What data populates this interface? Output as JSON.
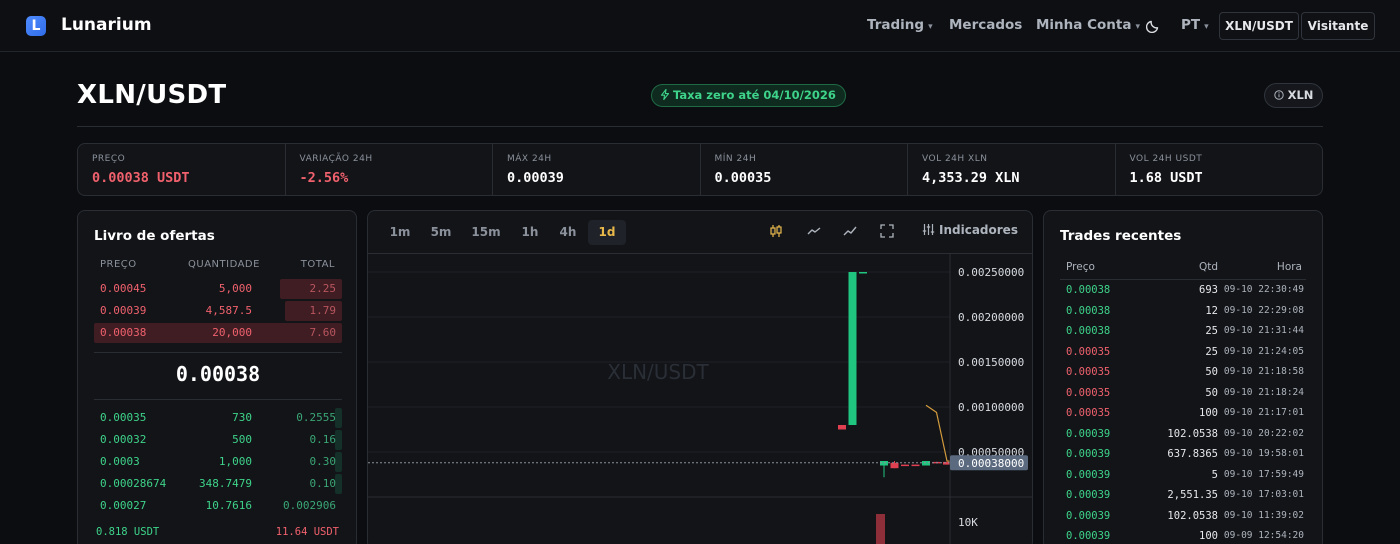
{
  "nav": {
    "brand": "Lunarium",
    "logo_letter": "L",
    "items": [
      {
        "label": "Trading",
        "caret": "▾"
      },
      {
        "label": "Mercados",
        "caret": ""
      },
      {
        "label": "Minha Conta",
        "caret": "▾"
      },
      {
        "label": "PT",
        "caret": "▾"
      }
    ],
    "pair_button": "XLN/USDT",
    "user_button": "Visitante"
  },
  "header": {
    "pair": "XLN/USDT",
    "fee_badge": "Taxa zero até 04/10/2026",
    "info_label": "XLN"
  },
  "stats": [
    {
      "label": "PREÇO",
      "value": "0.00038 USDT",
      "tone": "red"
    },
    {
      "label": "VARIAÇÃO 24H",
      "value": "-2.56%",
      "tone": "red"
    },
    {
      "label": "MÁX 24H",
      "value": "0.00039",
      "tone": "white"
    },
    {
      "label": "MÍN 24H",
      "value": "0.00035",
      "tone": "white"
    },
    {
      "label": "VOL 24H XLN",
      "value": "4,353.29 XLN",
      "tone": "white"
    },
    {
      "label": "VOL 24H USDT",
      "value": "1.68 USDT",
      "tone": "white"
    }
  ],
  "orderbook": {
    "title": "Livro de ofertas",
    "headers": [
      "PREÇO",
      "QUANTIDADE",
      "TOTAL"
    ],
    "asks": [
      {
        "price": "0.00045",
        "qty": "5,000",
        "total": "2.25",
        "depth": 0.25
      },
      {
        "price": "0.00039",
        "qty": "4,587.5",
        "total": "1.79",
        "depth": 0.23
      },
      {
        "price": "0.00038",
        "qty": "20,000",
        "total": "7.60",
        "depth": 1.0
      }
    ],
    "mid": "0.00038",
    "bids": [
      {
        "price": "0.00035",
        "qty": "730",
        "total": "0.2555",
        "depth": 0.03
      },
      {
        "price": "0.00032",
        "qty": "500",
        "total": "0.16",
        "depth": 0.03
      },
      {
        "price": "0.0003",
        "qty": "1,000",
        "total": "0.30",
        "depth": 0.03
      },
      {
        "price": "0.00028674",
        "qty": "348.7479",
        "total": "0.10",
        "depth": 0.03
      },
      {
        "price": "0.00027",
        "qty": "10.7616",
        "total": "0.002906",
        "depth": 0.0
      }
    ],
    "footer_bid": "0.818 USDT",
    "footer_ask": "11.64 USDT"
  },
  "chart": {
    "timeframes": [
      "1m",
      "5m",
      "15m",
      "1h",
      "4h",
      "1d"
    ],
    "active_timeframe": "1d",
    "indicators_label": "Indicadores",
    "watermark": "XLN/USDT",
    "price_ticks": [
      "0.00250000",
      "0.00200000",
      "0.00150000",
      "0.00100000",
      "0.00050000"
    ],
    "current_price_label": "0.00038000",
    "volume_tick": "10K",
    "colors": {
      "up": "#20c57f",
      "down": "#e0404f",
      "ma": "#d29a3c"
    }
  },
  "chart_data": {
    "type": "candlestick",
    "ylim": [
      0,
      0.0027
    ],
    "current_price": 0.00038,
    "candles": [
      {
        "open": 0.0008,
        "high": 0.0008,
        "low": 0.00075,
        "close": 0.00075
      },
      {
        "open": 0.0008,
        "high": 0.0025,
        "low": 0.0008,
        "close": 0.0025
      },
      {
        "open": 0.0025,
        "high": 0.0025,
        "low": 0.0025,
        "close": 0.0025
      },
      {
        "open": null,
        "high": null,
        "low": null,
        "close": null
      },
      {
        "open": 0.00035,
        "high": 0.0004,
        "low": 0.00022,
        "close": 0.0004
      },
      {
        "open": 0.00038,
        "high": 0.0004,
        "low": 0.00032,
        "close": 0.00032
      },
      {
        "open": 0.00036,
        "high": 0.00036,
        "low": 0.00035,
        "close": 0.00035
      },
      {
        "open": 0.00036,
        "high": 0.00036,
        "low": 0.00035,
        "close": 0.00035
      },
      {
        "open": 0.00035,
        "high": 0.0004,
        "low": 0.00035,
        "close": 0.0004
      },
      {
        "open": 0.00039,
        "high": 0.00039,
        "low": 0.00038,
        "close": 0.00038
      },
      {
        "open": 0.00039,
        "high": 0.00039,
        "low": 0.00036,
        "close": 0.00036
      },
      {
        "open": 0.00038,
        "high": 0.0004,
        "low": 0.00037,
        "close": 0.00037
      }
    ],
    "ma": [
      null,
      null,
      null,
      null,
      null,
      null,
      null,
      null,
      0.00102,
      0.00094,
      0.0004,
      0.00039
    ]
  },
  "trades": {
    "title": "Trades recentes",
    "headers": [
      "Preço",
      "Qtd",
      "Hora"
    ],
    "rows": [
      {
        "price": "0.00038",
        "qty": "693",
        "time": "09-10 22:30:49",
        "side": "buy"
      },
      {
        "price": "0.00038",
        "qty": "12",
        "time": "09-10 22:29:08",
        "side": "buy"
      },
      {
        "price": "0.00038",
        "qty": "25",
        "time": "09-10 21:31:44",
        "side": "buy"
      },
      {
        "price": "0.00035",
        "qty": "25",
        "time": "09-10 21:24:05",
        "side": "sell"
      },
      {
        "price": "0.00035",
        "qty": "50",
        "time": "09-10 21:18:58",
        "side": "sell"
      },
      {
        "price": "0.00035",
        "qty": "50",
        "time": "09-10 21:18:24",
        "side": "sell"
      },
      {
        "price": "0.00035",
        "qty": "100",
        "time": "09-10 21:17:01",
        "side": "sell"
      },
      {
        "price": "0.00039",
        "qty": "102.0538",
        "time": "09-10 20:22:02",
        "side": "buy"
      },
      {
        "price": "0.00039",
        "qty": "637.8365",
        "time": "09-10 19:58:01",
        "side": "buy"
      },
      {
        "price": "0.00039",
        "qty": "5",
        "time": "09-10 17:59:49",
        "side": "buy"
      },
      {
        "price": "0.00039",
        "qty": "2,551.35",
        "time": "09-10 17:03:01",
        "side": "buy"
      },
      {
        "price": "0.00039",
        "qty": "102.0538",
        "time": "09-10 11:39:02",
        "side": "buy"
      },
      {
        "price": "0.00039",
        "qty": "100",
        "time": "09-09 12:54:20",
        "side": "buy"
      }
    ]
  }
}
